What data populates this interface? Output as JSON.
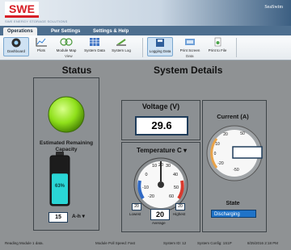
{
  "app": {
    "logo_text": "SWE",
    "brand_line": "SWE ENERGY STORAGE SOLUTIONS",
    "corner_brand": "SeaSwim"
  },
  "tabs": [
    {
      "label": "Operations",
      "active": true
    },
    {
      "label": "Pwr Settings",
      "active": false
    },
    {
      "label": "Settings & Help",
      "active": false
    }
  ],
  "ribbon": {
    "view_buttons": [
      {
        "label": "Dashboard",
        "icon": "dashboard-icon",
        "active": true
      },
      {
        "label": "Plots",
        "icon": "plot-icon",
        "active": false
      },
      {
        "label": "Module Map",
        "icon": "module-map-icon",
        "active": false
      },
      {
        "label": "System Data",
        "icon": "table-icon",
        "active": false
      },
      {
        "label": "System Log",
        "icon": "log-icon",
        "active": false
      }
    ],
    "view_group": "View",
    "data_buttons": [
      {
        "label": "Logging Data",
        "icon": "logging-icon",
        "active": true
      },
      {
        "label": "Print Screen",
        "icon": "print-screen-icon",
        "active": false
      },
      {
        "label": "Print to File",
        "icon": "print-file-icon",
        "active": false
      }
    ],
    "data_group": "Data"
  },
  "status": {
    "title": "Status",
    "indicator_color": "#8fe01a",
    "capacity_label": "Estimated Remaining Capacity",
    "capacity_percent_text": "63%",
    "capacity_fraction": 0.63,
    "capacity_value": "15",
    "capacity_unit": "A-h ▾"
  },
  "system": {
    "title": "System Details",
    "voltage_label": "Voltage (V)",
    "voltage_value": "29.6",
    "temperature_label": "Temperature C ▾",
    "temp_ticks": [
      "10",
      "20",
      "30",
      "0",
      "40",
      "-10",
      "50",
      "-20",
      "60"
    ],
    "temp_lowest_label": "Lowest",
    "temp_lowest_value": "20",
    "temp_highest_label": "Highest",
    "temp_highest_value": "20",
    "temp_average_label": "Average",
    "temp_average_value": "20",
    "current_label": "Current (A)",
    "current_ticks": [
      "20",
      "50",
      "10",
      "0",
      "-20",
      "-50"
    ],
    "state_label": "State",
    "state_value": "Discharging"
  },
  "statusbar": {
    "reading": "Reading Module 1 data.",
    "poll_speed": "Module Poll Speed: Fast",
    "system_id": "System ID: 12",
    "system_config": "System Config: 1S1P",
    "datetime": "8/25/2016  2:18 PM"
  }
}
